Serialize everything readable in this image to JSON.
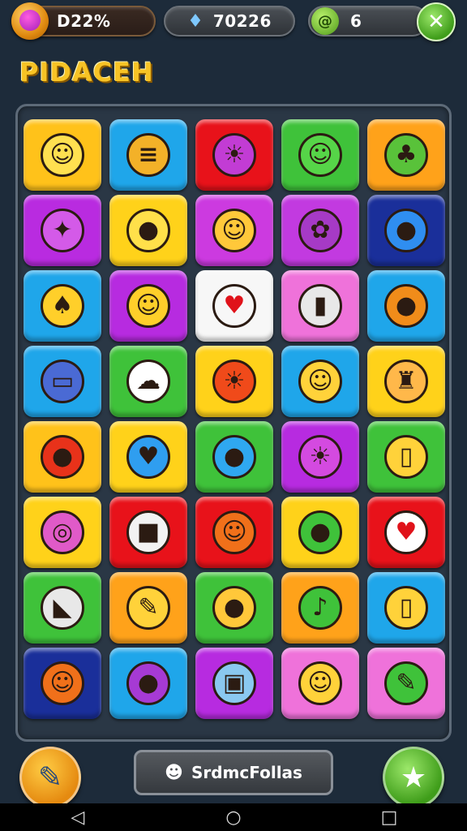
{
  "status": {
    "coins": "D22%",
    "gems": "70226",
    "moves": "6"
  },
  "title": "PIDACEH",
  "board": {
    "tiles": [
      {
        "bg": "#ffc21a",
        "icon": "winged-fruit-icon",
        "glyph": "☺",
        "glyph_bg": "#ffe050"
      },
      {
        "bg": "#1fa6ea",
        "icon": "burger-icon",
        "glyph": "≡",
        "glyph_bg": "#f3b128"
      },
      {
        "bg": "#e8121a",
        "icon": "sun-icon",
        "glyph": "☀",
        "glyph_bg": "#c23cd4"
      },
      {
        "bg": "#3fc23a",
        "icon": "speech-bubble-icon",
        "glyph": "☺",
        "glyph_bg": "#56d548"
      },
      {
        "bg": "#ffa21a",
        "icon": "cactus-icon",
        "glyph": "♣",
        "glyph_bg": "#59c23a"
      },
      {
        "bg": "#b92be0",
        "icon": "map-icon",
        "glyph": "✦",
        "glyph_bg": "#d45ae8"
      },
      {
        "bg": "#ffd21a",
        "icon": "chat-bubble-icon",
        "glyph": "●",
        "glyph_bg": "#ffe04a"
      },
      {
        "bg": "#cc3ae0",
        "icon": "winged-fruit-icon",
        "glyph": "☺",
        "glyph_bg": "#ffc83a"
      },
      {
        "bg": "#c23ae0",
        "icon": "octopus-icon",
        "glyph": "✿",
        "glyph_bg": "#a63ac6"
      },
      {
        "bg": "#1a2f9a",
        "icon": "balloon-icon",
        "glyph": "●",
        "glyph_bg": "#2f8ef0"
      },
      {
        "bg": "#1fa6ea",
        "icon": "ice-cream-icon",
        "glyph": "♠",
        "glyph_bg": "#ffcf2a"
      },
      {
        "bg": "#b72be0",
        "icon": "smiley-blob-icon",
        "glyph": "☺",
        "glyph_bg": "#ffcf2a"
      },
      {
        "bg": "#f7f7f7",
        "icon": "heart-icon",
        "glyph": "♥",
        "glyph_bg": "#f7f7f7"
      },
      {
        "bg": "#ef72da",
        "icon": "card-icon",
        "glyph": "▮",
        "glyph_bg": "#e8e8e8"
      },
      {
        "bg": "#1fa6ea",
        "icon": "egg-icon",
        "glyph": "●",
        "glyph_bg": "#f08c1a"
      },
      {
        "bg": "#1fa6ea",
        "icon": "phone-icon",
        "glyph": "▭",
        "glyph_bg": "#4a6ad4"
      },
      {
        "bg": "#3fc23a",
        "icon": "cloud-icon",
        "glyph": "☁",
        "glyph_bg": "#ffffff"
      },
      {
        "bg": "#ffd21a",
        "icon": "sun-icon",
        "glyph": "☀",
        "glyph_bg": "#f04a1a"
      },
      {
        "bg": "#1fa6ea",
        "icon": "smiley-blob-icon",
        "glyph": "☺",
        "glyph_bg": "#ffd23a"
      },
      {
        "bg": "#ffd21a",
        "icon": "chef-icon",
        "glyph": "♜",
        "glyph_bg": "#ffb84a"
      },
      {
        "bg": "#ffc21a",
        "icon": "tomato-icon",
        "glyph": "●",
        "glyph_bg": "#e8321a"
      },
      {
        "bg": "#ffd21a",
        "icon": "bird-icon",
        "glyph": "♥",
        "glyph_bg": "#2f9ef0"
      },
      {
        "bg": "#3fc23a",
        "icon": "balloon-icon",
        "glyph": "●",
        "glyph_bg": "#2fa8f0"
      },
      {
        "bg": "#b72be0",
        "icon": "sun-icon",
        "glyph": "☀",
        "glyph_bg": "#d44ae0"
      },
      {
        "bg": "#3fc23a",
        "icon": "cup-icon",
        "glyph": "▯",
        "glyph_bg": "#ffd23a"
      },
      {
        "bg": "#ffd21a",
        "icon": "swirl-icon",
        "glyph": "◎",
        "glyph_bg": "#e05ac8"
      },
      {
        "bg": "#e8121a",
        "icon": "box-icon",
        "glyph": "■",
        "glyph_bg": "#f2f2f2"
      },
      {
        "bg": "#e8121a",
        "icon": "winged-fruit-icon",
        "glyph": "☺",
        "glyph_bg": "#f0701a"
      },
      {
        "bg": "#ffd21a",
        "icon": "chat-bubble-icon",
        "glyph": "●",
        "glyph_bg": "#3fc23a"
      },
      {
        "bg": "#e8121a",
        "icon": "heart-badge-icon",
        "glyph": "♥",
        "glyph_bg": "#ffffff"
      },
      {
        "bg": "#3fc23a",
        "icon": "sail-icon",
        "glyph": "◣",
        "glyph_bg": "#e8e8e8"
      },
      {
        "bg": "#ffa21a",
        "icon": "pencil-icon",
        "glyph": "✎",
        "glyph_bg": "#ffd23a"
      },
      {
        "bg": "#3fc23a",
        "icon": "lemon-icon",
        "glyph": "●",
        "glyph_bg": "#ffc83a"
      },
      {
        "bg": "#ffa21a",
        "icon": "microphone-icon",
        "glyph": "♪",
        "glyph_bg": "#3fc23a"
      },
      {
        "bg": "#1fa6ea",
        "icon": "bottle-icon",
        "glyph": "▯",
        "glyph_bg": "#ffd23a"
      },
      {
        "bg": "#1a2f9a",
        "icon": "winged-fruit-icon",
        "glyph": "☺",
        "glyph_bg": "#f0701a"
      },
      {
        "bg": "#1fa6ea",
        "icon": "balloon-icon",
        "glyph": "●",
        "glyph_bg": "#a63ad4"
      },
      {
        "bg": "#b72be0",
        "icon": "robot-icon",
        "glyph": "▣",
        "glyph_bg": "#8ac8f0"
      },
      {
        "bg": "#ef72da",
        "icon": "octopus-icon",
        "glyph": "☺",
        "glyph_bg": "#ffd23a"
      },
      {
        "bg": "#ef72da",
        "icon": "paintbrush-icon",
        "glyph": "✎",
        "glyph_bg": "#3fc23a"
      }
    ]
  },
  "bottom": {
    "center_label": "SrdmcFollas",
    "left_icon": "feather-icon",
    "right_icon": "star-icon"
  },
  "nav": {
    "back": "◁",
    "home": "○",
    "recent": "□"
  }
}
